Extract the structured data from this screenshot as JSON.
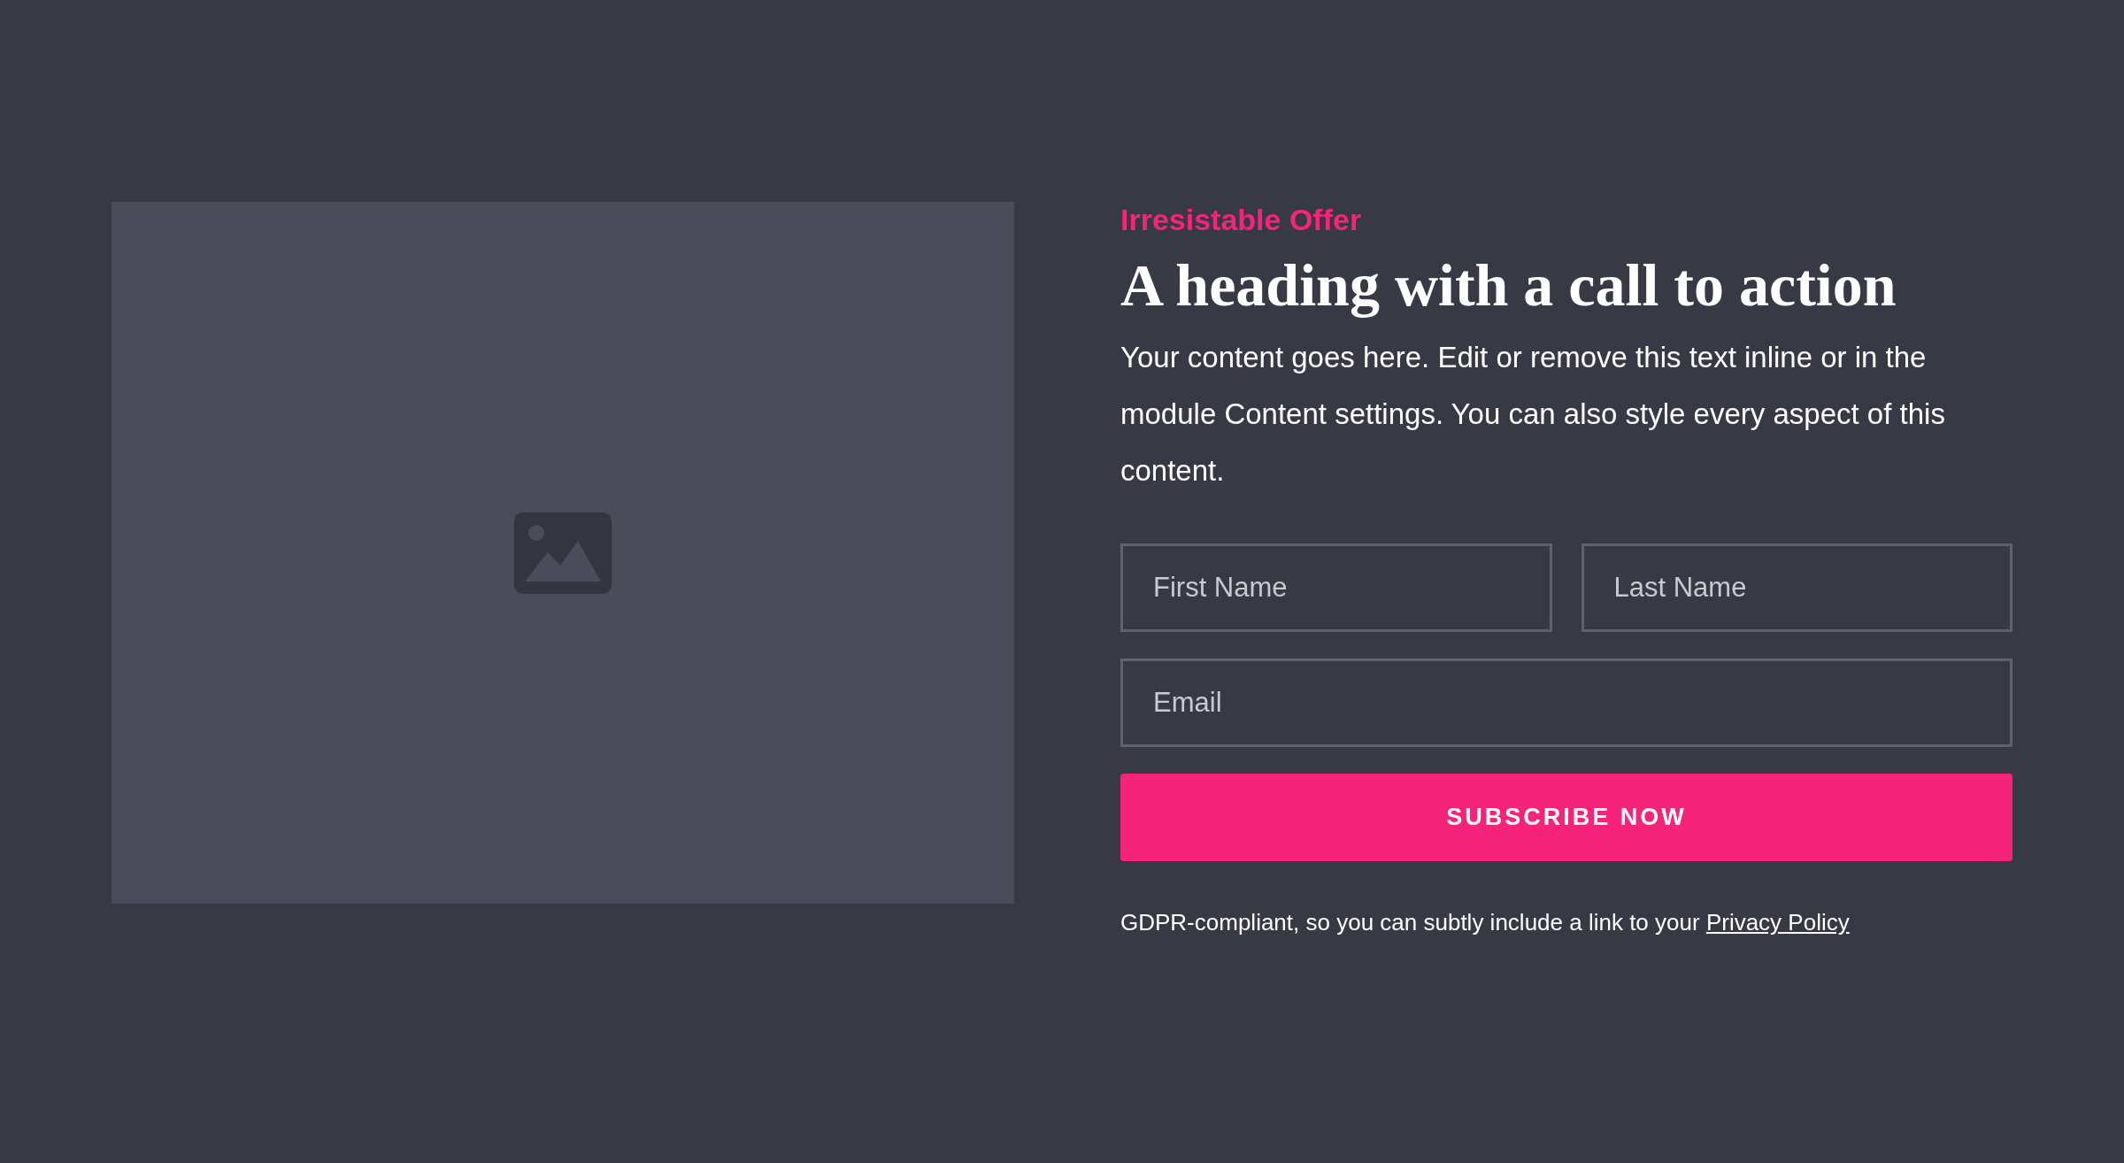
{
  "media": {
    "kind": "placeholder"
  },
  "offer": {
    "eyebrow": "Irresistable Offer",
    "heading": "A heading with a call to action",
    "body": "Your content goes here. Edit or remove this text inline or in the module Content settings. You can also style every aspect of this content."
  },
  "form": {
    "fields": [
      {
        "placeholder": "First Name"
      },
      {
        "placeholder": "Last Name"
      },
      {
        "placeholder": "Email"
      }
    ],
    "button": "SUBSCRIBE NOW",
    "note": "GDPR-compliant, so you can subtly include a link to your",
    "link": "Privacy Policy"
  }
}
